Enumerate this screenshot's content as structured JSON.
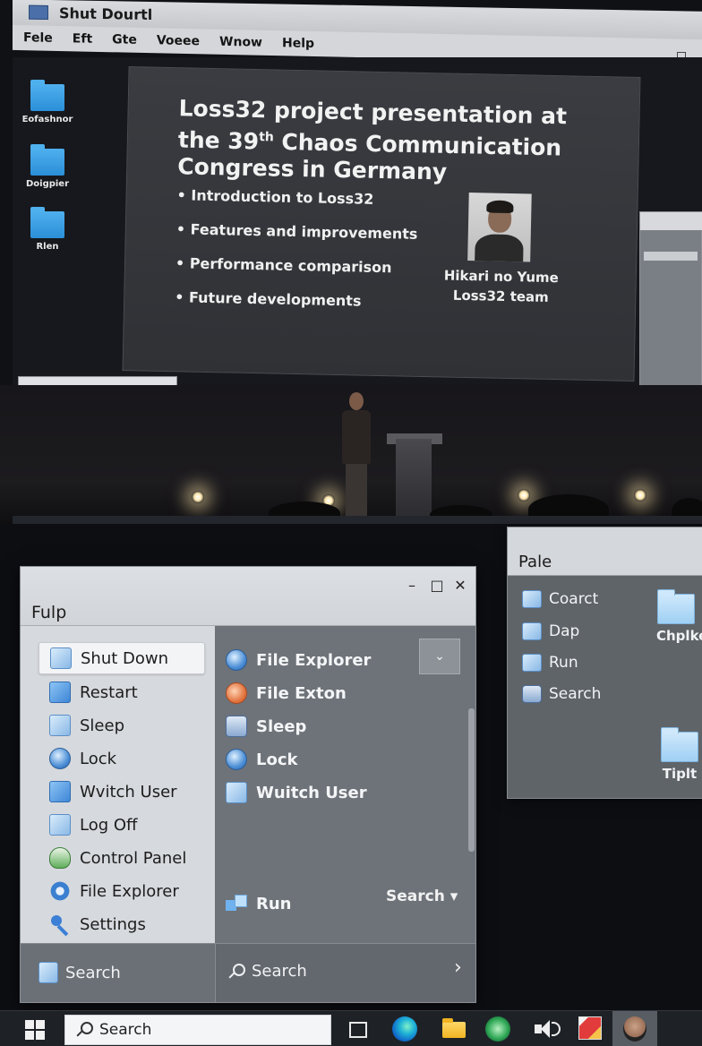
{
  "projection": {
    "window_title": "Shut Dourtl",
    "menu": [
      "Fele",
      "Eft",
      "Gte",
      "Voeee",
      "Wnow",
      "Help"
    ],
    "desktop_icons": [
      {
        "label": "Eofashnor"
      },
      {
        "label": "Doigpier"
      },
      {
        "label": "Rlen"
      }
    ],
    "slide": {
      "title_pre": "Loss32 project presentation at the 39",
      "title_sup": "th",
      "title_post": " Chaos Communication Congress in Germany",
      "bullets": [
        "Introduction to Loss32",
        "Features and improvements",
        "Performance comparison",
        "Future developments"
      ],
      "speaker_name": "Hikari no Yume",
      "speaker_team": "Loss32 team"
    }
  },
  "start_menu": {
    "title": "Fulp",
    "left_items": [
      {
        "label": "Shut Down",
        "icon": "shutdown-icon",
        "selected": true
      },
      {
        "label": "Restart",
        "icon": "restart-icon"
      },
      {
        "label": "Sleep",
        "icon": "sleep-icon"
      },
      {
        "label": "Lock",
        "icon": "lock-icon"
      },
      {
        "label": "Wvitch User",
        "icon": "switch-user-icon"
      },
      {
        "label": "Log Off",
        "icon": "log-off-icon"
      },
      {
        "label": "Control Panel",
        "icon": "control-panel-icon"
      },
      {
        "label": "File Explorer",
        "icon": "file-explorer-icon"
      },
      {
        "label": "Settings",
        "icon": "settings-icon"
      }
    ],
    "right_items": [
      {
        "label": "File Explorer",
        "icon": "file-explorer-icon"
      },
      {
        "label": "File Exton",
        "icon": "file-exton-icon"
      },
      {
        "label": "Sleep",
        "icon": "sleep-icon"
      },
      {
        "label": "Lock",
        "icon": "lock-icon"
      },
      {
        "label": "Wuitch User",
        "icon": "switch-user-icon"
      }
    ],
    "run_label": "Run",
    "search_dropdown_label": "Search ▾",
    "bottom_left_search": "Search",
    "bottom_right_search": "Search",
    "chevron_right": "›"
  },
  "file_window": {
    "title": "Pale",
    "items": [
      {
        "label": "Coarct",
        "icon": "check-icon"
      },
      {
        "label": "Dap",
        "icon": "folder-icon"
      },
      {
        "label": "Run",
        "icon": "folder-icon"
      },
      {
        "label": "Search",
        "icon": "search-icon"
      }
    ],
    "folders": [
      {
        "label": "Chplke"
      },
      {
        "label": "Tiplt"
      }
    ]
  },
  "taskbar": {
    "search_label": "Search"
  },
  "colors": {
    "menu_left_bg": "#d6d9dd",
    "menu_right_bg": "#6e7379",
    "selected_bg": "#f3f4f6",
    "folder_blue": "#9fd0f4"
  }
}
